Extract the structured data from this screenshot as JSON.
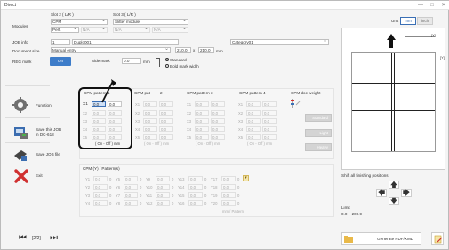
{
  "window": {
    "title": "Direct",
    "minimize": "—",
    "maximize": "□",
    "close": "✕"
  },
  "modules": {
    "label": "Modules",
    "slot2_label": "Slot 2 ( L/R )",
    "slot3_label": "Slot 3 ( L/R )",
    "slot2_value": "CPM",
    "slot2_sub": "Perf.",
    "slot2_na": "N/A",
    "slot3_value": "Slitter module",
    "slot3_na1": "N/A",
    "slot3_na2": "N/A"
  },
  "job_info": {
    "label": "JOB info",
    "number": "1",
    "name": "Duplo001",
    "category": "Category01"
  },
  "document_size": {
    "label": "Document size",
    "mode": "Manual entry",
    "width": "210.0",
    "x_sep": "x",
    "height": "210.0",
    "unit": "mm"
  },
  "reg_mark": {
    "label": "REG mark",
    "toggle": "On",
    "side_mark_label": "Side mark",
    "side_mark_value": "0.0",
    "unit": "mm",
    "opt_standard": "Standard",
    "opt_bold": "Bold mark width"
  },
  "cpm": {
    "pattern1_title": "CPM pattern 1",
    "pattern2_title": "CPM pat",
    "pattern2_rest": "2",
    "pattern3_title": "CPM pattern 3",
    "pattern4_title": "CPM pattern 4",
    "doc_weight_title": "CPM doc weight",
    "rows": [
      {
        "label": "X1",
        "value": "0.0",
        "value2": "0.0"
      },
      {
        "label": "X2",
        "value": "0.0",
        "value2": "0.0"
      },
      {
        "label": "X3",
        "value": "0.0",
        "value2": "0.0"
      },
      {
        "label": "X4",
        "value": "0.0",
        "value2": "0.0"
      },
      {
        "label": "X5",
        "value": "0.0",
        "value2": "0.0"
      }
    ],
    "onoff": "( On - Off ) mm",
    "weight_standard": "Standard",
    "weight_light": "Light",
    "weight_heavy": "Heavy",
    "patterns_title": "CPM (Y) / Pattern(s)",
    "y_rows": [
      {
        "a": "Y1",
        "b": "Y5",
        "c": "Y9",
        "d": "Y13",
        "e": "Y17"
      },
      {
        "a": "Y2",
        "b": "Y6",
        "c": "Y10",
        "d": "Y14",
        "e": "Y18"
      },
      {
        "a": "Y3",
        "b": "Y7",
        "c": "Y11",
        "d": "Y15",
        "e": "Y19"
      },
      {
        "a": "Y4",
        "b": "Y8",
        "c": "Y12",
        "d": "Y16",
        "e": "Y20"
      }
    ],
    "y_value": "0.0",
    "y_zero": "0",
    "mm_pattern": "mm / Pattern"
  },
  "sidebar": {
    "function": "Function",
    "save_job": "Save this JOB in DC-618",
    "save_file": "Save JOB file",
    "exit": "Exit"
  },
  "pager": {
    "text": "[2/2]"
  },
  "right": {
    "unit_label": "Unit",
    "unit_mm": "mm",
    "unit_inch": "inch",
    "x_label": "[X]",
    "y_label": "[Y]",
    "shift_label": "Shift all finishing positions",
    "limit_label": "Limit",
    "limit_value": "0.0 ~ 209.9",
    "generate": "Generate PDF/XML"
  },
  "colors": {
    "accent": "#3a6fb5",
    "red": "#d03030",
    "blue_toggle": "#3d7cc9",
    "highlight_border": "#111111"
  }
}
